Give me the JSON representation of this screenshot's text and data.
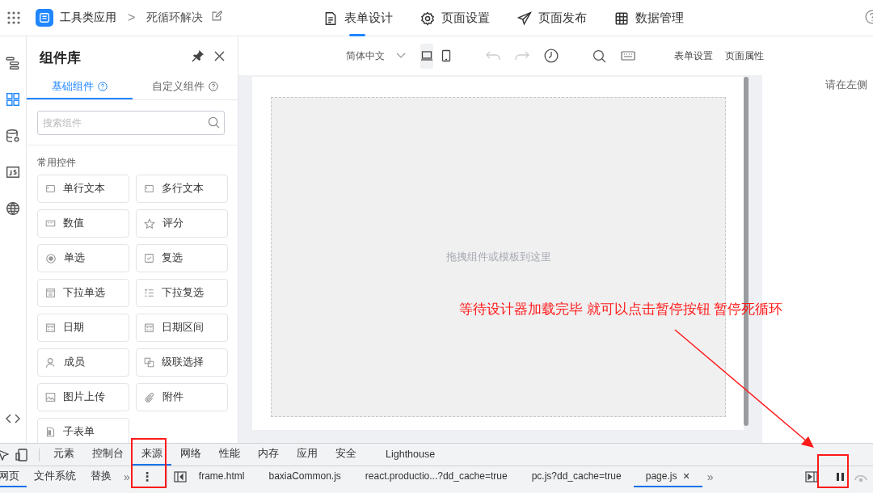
{
  "header": {
    "app_name": "工具类应用",
    "breadcrumb_separator": ">",
    "page_name": "死循环解决"
  },
  "nav_tabs": [
    {
      "label": "表单设计",
      "kind": "doc",
      "selected": true
    },
    {
      "label": "页面设置",
      "kind": "gear",
      "selected": false
    },
    {
      "label": "页面发布",
      "kind": "send",
      "selected": false
    },
    {
      "label": "数据管理",
      "kind": "table",
      "selected": false
    }
  ],
  "rail": [
    {
      "kind": "outline",
      "selected": false
    },
    {
      "kind": "grid",
      "selected": true
    },
    {
      "kind": "database",
      "selected": false
    },
    {
      "kind": "js",
      "selected": false
    },
    {
      "kind": "globe",
      "selected": false
    }
  ],
  "panel": {
    "title": "组件库",
    "tabs": [
      {
        "label": "基础组件",
        "selected": true
      },
      {
        "label": "自定义组件",
        "selected": false
      }
    ],
    "search": {
      "placeholder": "搜索组件"
    },
    "group": "常用控件",
    "items": [
      {
        "label": "单行文本",
        "kind": "text"
      },
      {
        "label": "多行文本",
        "kind": "text"
      },
      {
        "label": "数值",
        "kind": "number"
      },
      {
        "label": "评分",
        "kind": "star"
      },
      {
        "label": "单选",
        "kind": "radio"
      },
      {
        "label": "复选",
        "kind": "checkbox"
      },
      {
        "label": "下拉单选",
        "kind": "select"
      },
      {
        "label": "下拉复选",
        "kind": "multiselect"
      },
      {
        "label": "日期",
        "kind": "date"
      },
      {
        "label": "日期区间",
        "kind": "date"
      },
      {
        "label": "成员",
        "kind": "user"
      },
      {
        "label": "级联选择",
        "kind": "cascade"
      },
      {
        "label": "图片上传",
        "kind": "image"
      },
      {
        "label": "附件",
        "kind": "attachment"
      },
      {
        "label": "子表单",
        "kind": "subform"
      }
    ]
  },
  "toolbar": {
    "language": "简体中文",
    "devices": [
      {
        "kind": "desktop",
        "selected": true
      },
      {
        "kind": "tablet",
        "selected": false
      }
    ],
    "undo_disabled": true,
    "redo_disabled": true,
    "buttons": [
      "表单设置",
      "页面属性"
    ]
  },
  "canvas": {
    "placeholder": "拖拽组件或模板到这里"
  },
  "right_panel": {
    "hint": "请在左侧"
  },
  "annotation": {
    "text": "等待设计器加载完毕 就可以点击暂停按钮 暂停死循环"
  },
  "devtools": {
    "tabs": [
      {
        "label": "元素",
        "selected": false
      },
      {
        "label": "控制台",
        "selected": false
      },
      {
        "label": "来源",
        "selected": true
      },
      {
        "label": "网络",
        "selected": false
      },
      {
        "label": "性能",
        "selected": false
      },
      {
        "label": "内存",
        "selected": false
      },
      {
        "label": "应用",
        "selected": false
      },
      {
        "label": "安全",
        "selected": false
      },
      {
        "label": "Lighthouse",
        "selected": false
      }
    ],
    "nav": [
      {
        "label": "网页",
        "selected": true
      },
      {
        "label": "文件系统",
        "selected": false
      },
      {
        "label": "替换",
        "selected": false
      }
    ],
    "nav_more": "»",
    "menu": "⋮",
    "files": [
      {
        "label": "frame.html",
        "selected": false
      },
      {
        "label": "baxiaCommon.js",
        "selected": false
      },
      {
        "label": "react.productio...?dd_cache=true",
        "selected": false
      },
      {
        "label": "pc.js?dd_cache=true",
        "selected": false
      },
      {
        "label": "page.js",
        "selected": true,
        "close": "✕"
      }
    ],
    "files_more": "»"
  }
}
